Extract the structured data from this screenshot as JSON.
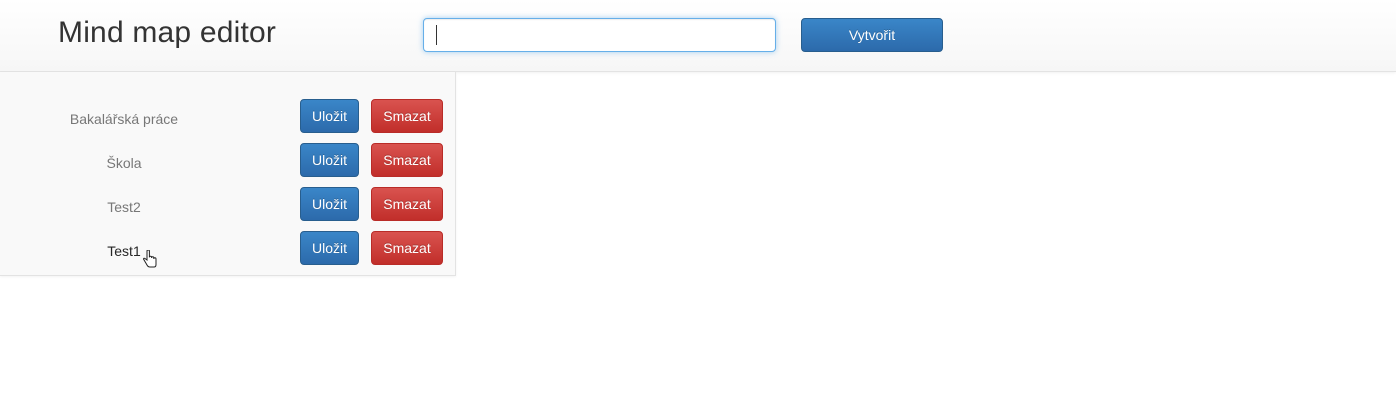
{
  "header": {
    "title": "Mind map editor",
    "search_value": "",
    "create_label": "Vytvořit"
  },
  "sidebar": {
    "items": [
      {
        "name": "Bakalářská práce",
        "save_label": "Uložit",
        "delete_label": "Smazat"
      },
      {
        "name": "Škola",
        "save_label": "Uložit",
        "delete_label": "Smazat"
      },
      {
        "name": "Test2",
        "save_label": "Uložit",
        "delete_label": "Smazat"
      },
      {
        "name": "Test1",
        "save_label": "Uložit",
        "delete_label": "Smazat"
      }
    ]
  },
  "colors": {
    "primary": "#337ab7",
    "danger": "#d9534f",
    "focus": "#66afe9"
  },
  "icons": {
    "cursor": "hand-pointer-icon"
  }
}
